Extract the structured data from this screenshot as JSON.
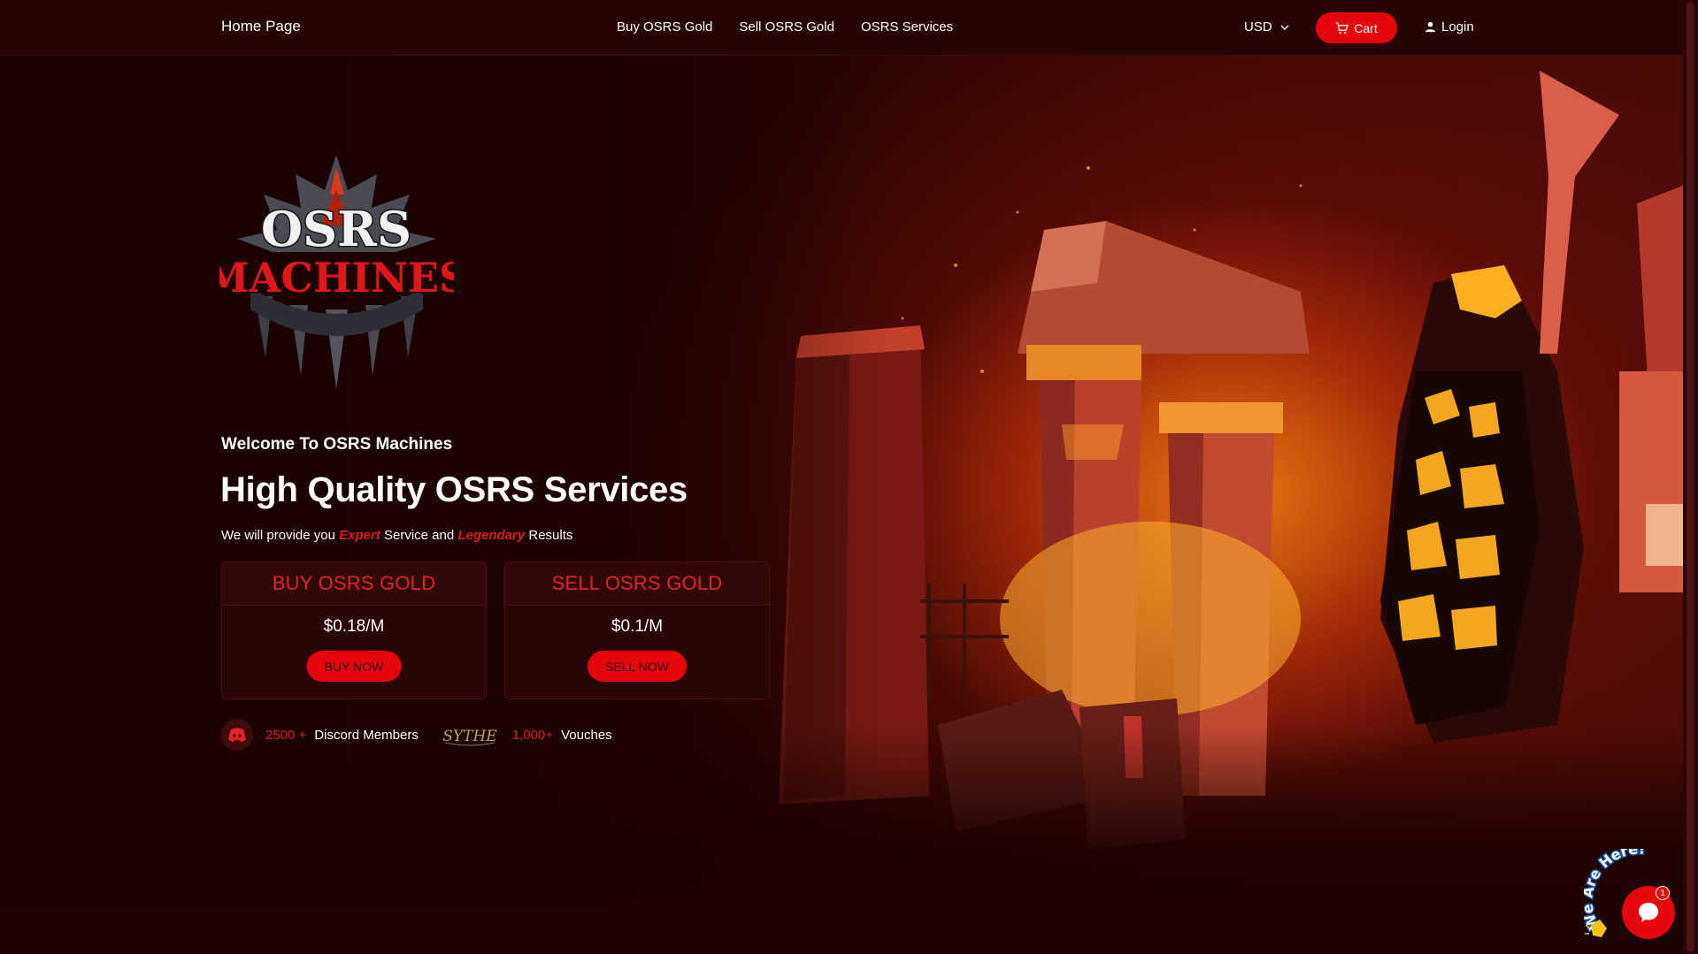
{
  "header": {
    "home_label": "Home Page",
    "nav": [
      {
        "label": "Buy OSRS Gold"
      },
      {
        "label": "Sell OSRS Gold"
      },
      {
        "label": "OSRS Services"
      }
    ],
    "currency": "USD",
    "cart_label": "Cart",
    "login_label": "Login"
  },
  "logo": {
    "line1": "OSRS",
    "line2": "MACHINES"
  },
  "hero": {
    "welcome": "Welcome To OSRS Machines",
    "headline": "High Quality OSRS Services",
    "sub_prefix": "We will provide you ",
    "sub_accent1": "Expert",
    "sub_middle": " Service and ",
    "sub_accent2": "Legendary",
    "sub_suffix": " Results"
  },
  "cards": {
    "buy": {
      "title": "BUY OSRS GOLD",
      "price": "$0.18/M",
      "button": "BUY NOW"
    },
    "sell": {
      "title": "SELL OSRS GOLD",
      "price": "$0.1/M",
      "button": "SELL NOW"
    }
  },
  "stats": {
    "discord_count": "2500 +",
    "discord_label": "Discord Members",
    "sythe_logo": "SYTHE",
    "vouches_count": "1,000+",
    "vouches_label": "Vouches"
  },
  "chat": {
    "tagline": "We Are Here!",
    "unread": "1"
  },
  "colors": {
    "accent": "#e4060a",
    "header_bg": "#280505",
    "page_bg": "#1a0202"
  },
  "icons": [
    "chevron-down-icon",
    "cart-icon",
    "user-icon",
    "discord-icon",
    "chat-icon",
    "wave-hand-icon"
  ]
}
